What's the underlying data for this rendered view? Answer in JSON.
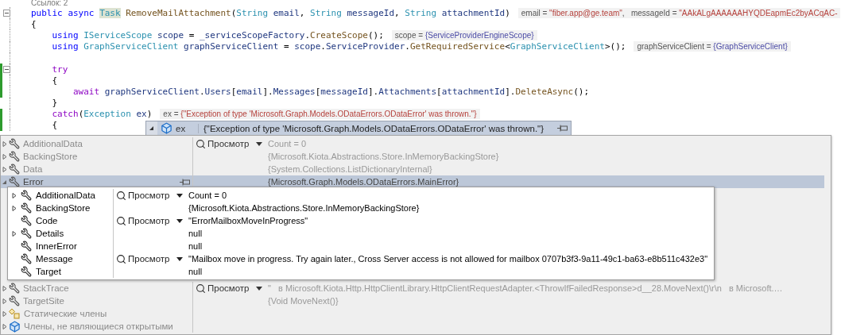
{
  "editor": {
    "codelens": "Ссылок: 2",
    "lines": [
      {
        "collapsible": true,
        "changed": false,
        "tokens": [
          {
            "text": "public",
            "kind": "keyword"
          },
          {
            "text": " async",
            "kind": "keyword"
          },
          {
            "text": " Task",
            "kind": "type",
            "highlighted": true
          },
          {
            "text": " RemoveMailAttachment",
            "kind": "method"
          },
          {
            "text": "("
          },
          {
            "text": "String",
            "kind": "type"
          },
          {
            "text": " email",
            "kind": "variable"
          },
          {
            "text": ", "
          },
          {
            "text": "String",
            "kind": "type"
          },
          {
            "text": " messageId",
            "kind": "variable"
          },
          {
            "text": ", "
          },
          {
            "text": "String",
            "kind": "type"
          },
          {
            "text": " attachmentId",
            "kind": "variable"
          },
          {
            "text": ")"
          }
        ],
        "hints": [
          {
            "parts": [
              {
                "text": "email = ",
                "kind": "name"
              },
              {
                "text": "\"fiber.app@ge.team\"",
                "kind": "string"
              },
              {
                "text": ",   messageId = ",
                "kind": "name"
              },
              {
                "text": "\"AAkALgAAAAAAHYQDEapmEc2byACqAC-",
                "kind": "string"
              }
            ]
          }
        ]
      },
      {
        "collapsible": false,
        "changed": false,
        "tokens": [
          {
            "text": "{"
          }
        ]
      },
      {
        "collapsible": false,
        "changed": false,
        "tokens": [
          {
            "text": "    using",
            "kind": "keyword"
          },
          {
            "text": " IServiceScope",
            "kind": "type"
          },
          {
            "text": " scope",
            "kind": "variable"
          },
          {
            "text": " = "
          },
          {
            "text": "_serviceScopeFactory",
            "kind": "variable"
          },
          {
            "text": "."
          },
          {
            "text": "CreateScope",
            "kind": "method"
          },
          {
            "text": "();"
          }
        ],
        "hints": [
          {
            "parts": [
              {
                "text": "scope = ",
                "kind": "name"
              },
              {
                "text": "{ServiceProviderEngineScope}",
                "kind": "object"
              }
            ]
          }
        ]
      },
      {
        "collapsible": false,
        "changed": false,
        "tokens": [
          {
            "text": "    using",
            "kind": "keyword"
          },
          {
            "text": " GraphServiceClient",
            "kind": "type"
          },
          {
            "text": " graphServiceClient",
            "kind": "variable"
          },
          {
            "text": " = "
          },
          {
            "text": "scope",
            "kind": "variable"
          },
          {
            "text": "."
          },
          {
            "text": "ServiceProvider",
            "kind": "variable"
          },
          {
            "text": "."
          },
          {
            "text": "GetRequiredService",
            "kind": "method"
          },
          {
            "text": "<"
          },
          {
            "text": "GraphServiceClient",
            "kind": "type"
          },
          {
            "text": ">();"
          }
        ],
        "hints": [
          {
            "parts": [
              {
                "text": "graphServiceClient = ",
                "kind": "name"
              },
              {
                "text": "{GraphServiceClient}",
                "kind": "object"
              }
            ]
          }
        ]
      },
      {
        "collapsible": false,
        "changed": false
      },
      {
        "collapsible": true,
        "changed": true,
        "tokens": [
          {
            "text": "    try",
            "kind": "control"
          }
        ]
      },
      {
        "collapsible": false,
        "changed": true,
        "tokens": [
          {
            "text": "    {"
          }
        ]
      },
      {
        "collapsible": false,
        "changed": true,
        "tokens": [
          {
            "text": "        await",
            "kind": "control"
          },
          {
            "text": " graphServiceClient",
            "kind": "variable"
          },
          {
            "text": "."
          },
          {
            "text": "Users",
            "kind": "variable"
          },
          {
            "text": "["
          },
          {
            "text": "email",
            "kind": "variable"
          },
          {
            "text": "]."
          },
          {
            "text": "Messages",
            "kind": "variable"
          },
          {
            "text": "["
          },
          {
            "text": "messageId",
            "kind": "variable"
          },
          {
            "text": "]."
          },
          {
            "text": "Attachments",
            "kind": "variable"
          },
          {
            "text": "["
          },
          {
            "text": "attachmentId",
            "kind": "variable"
          },
          {
            "text": "]."
          },
          {
            "text": "DeleteAsync",
            "kind": "method"
          },
          {
            "text": "();"
          }
        ]
      },
      {
        "collapsible": false,
        "changed": false,
        "tokens": [
          {
            "text": "    }"
          }
        ]
      },
      {
        "collapsible": false,
        "changed": true,
        "tokens": [
          {
            "text": "    catch",
            "kind": "control"
          },
          {
            "text": "("
          },
          {
            "text": "Exception",
            "kind": "type"
          },
          {
            "text": " ex",
            "kind": "variable"
          },
          {
            "text": ")"
          }
        ],
        "hints": [
          {
            "parts": [
              {
                "text": "ex = ",
                "kind": "name"
              },
              {
                "text": "{\"Exception of type 'Microsoft.Graph.Models.ODataErrors.ODataError' was thrown.\"}",
                "kind": "string"
              }
            ]
          }
        ]
      },
      {
        "collapsible": false,
        "changed": true,
        "tokens": [
          {
            "text": "    {"
          }
        ]
      }
    ]
  },
  "datatip": {
    "root": {
      "name": "ex",
      "expanded": true,
      "value": "{\"Exception of type 'Microsoft.Graph.Models.ODataErrors.ODataError' was thrown.\"}"
    },
    "rows": [
      {
        "name": "AdditionalData",
        "kind": "property",
        "expanded": false,
        "selected": false,
        "view": "Просмотр",
        "value": "Count = 0"
      },
      {
        "name": "BackingStore",
        "kind": "property",
        "expanded": false,
        "selected": false,
        "value": "{Microsoft.Kiota.Abstractions.Store.InMemoryBackingStore}"
      },
      {
        "name": "Data",
        "kind": "property",
        "expanded": false,
        "selected": false,
        "value": "{System.Collections.ListDictionaryInternal}"
      },
      {
        "name": "Error",
        "kind": "property",
        "expanded": true,
        "selected": true,
        "value": "{Microsoft.Graph.Models.ODataErrors.MainError}"
      },
      {
        "name": "StackTrace",
        "kind": "property",
        "expanded": false,
        "selected": false,
        "view": "Просмотр",
        "value": "\"   в Microsoft.Kiota.Http.HttpClientLibrary.HttpClientRequestAdapter.<ThrowIfFailedResponse>d__28.MoveNext()\\r\\n   в Microsoft.…"
      },
      {
        "name": "TargetSite",
        "kind": "property",
        "expanded": false,
        "selected": false,
        "value": "{Void MoveNext()}"
      },
      {
        "name": "Статические члены",
        "kind": "static",
        "expanded": false,
        "selected": false
      },
      {
        "name": "Члены, не являющиеся открытыми",
        "kind": "nonpublic",
        "expanded": false,
        "selected": false
      }
    ],
    "nested_rows": [
      {
        "name": "AdditionalData",
        "expandable": true,
        "view": "Просмотр",
        "value": "Count = 0"
      },
      {
        "name": "BackingStore",
        "expandable": true,
        "value": "{Microsoft.Kiota.Abstractions.Store.InMemoryBackingStore}"
      },
      {
        "name": "Code",
        "expandable": false,
        "view": "Просмотр",
        "value": "\"ErrorMailboxMoveInProgress\""
      },
      {
        "name": "Details",
        "expandable": true,
        "value": "null"
      },
      {
        "name": "InnerError",
        "expandable": false,
        "value": "null"
      },
      {
        "name": "Message",
        "expandable": false,
        "view": "Просмотр",
        "value": "\"Mailbox move in progress. Try again later., Cross Server access is not allowed for mailbox 0707b3f3-9a11-49c1-ba63-e8b511c432e3\""
      },
      {
        "name": "Target",
        "expandable": false,
        "value": "null"
      }
    ]
  }
}
